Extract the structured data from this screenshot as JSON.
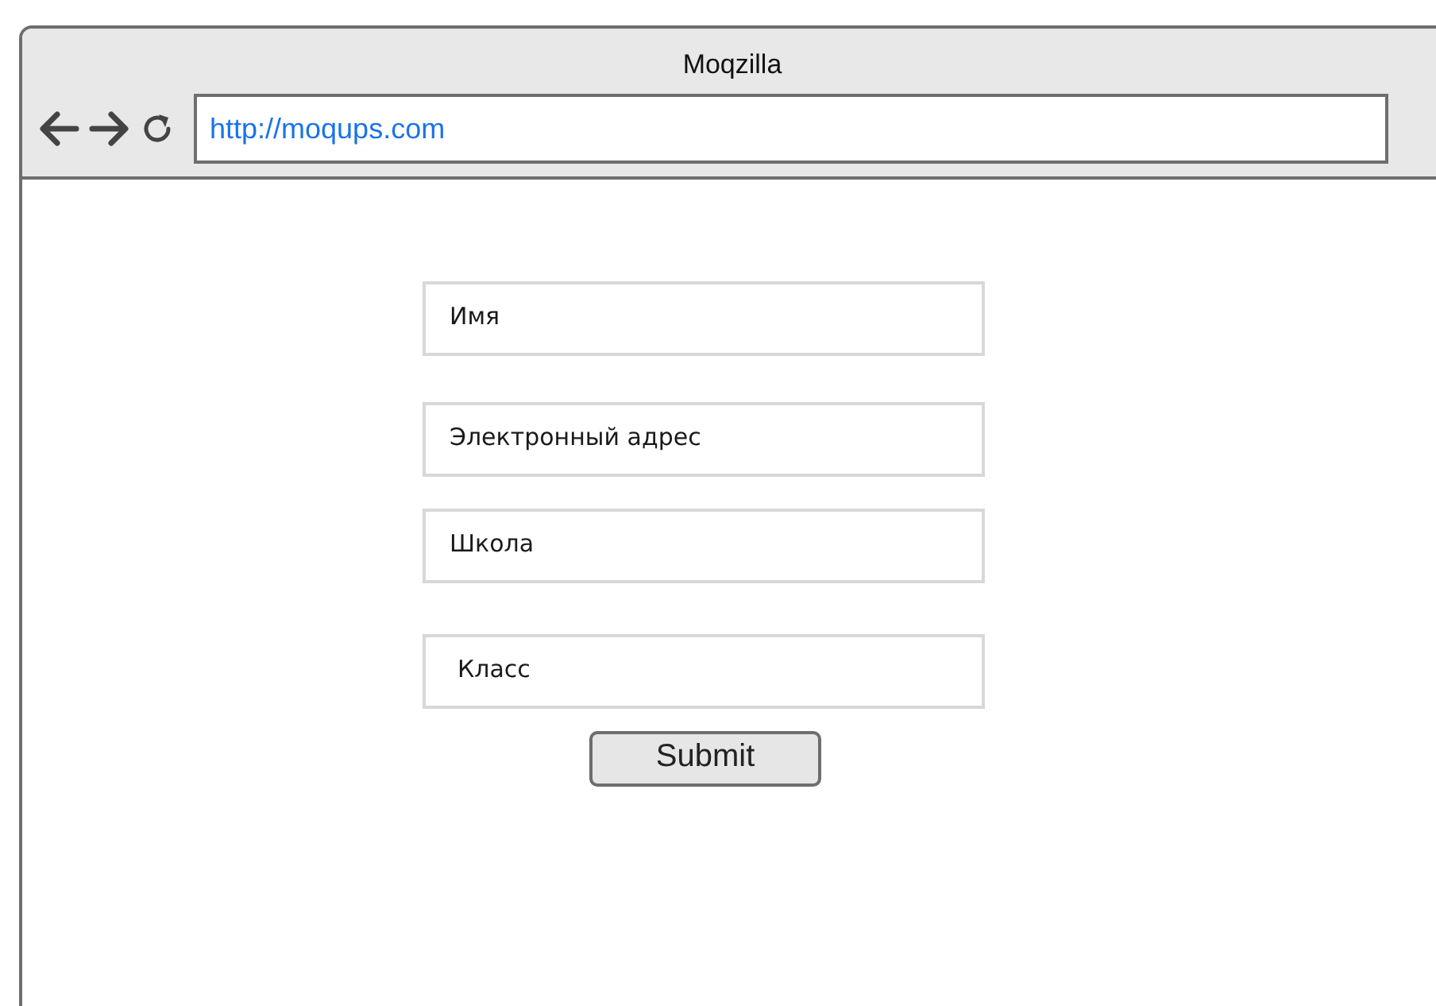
{
  "window": {
    "title": "Moqzilla"
  },
  "address_bar": {
    "value": "http://moqups.com"
  },
  "form": {
    "fields": [
      {
        "placeholder": "Имя"
      },
      {
        "placeholder": "Электронный адрес"
      },
      {
        "placeholder": "Школа"
      },
      {
        "placeholder": "Класс"
      }
    ],
    "submit": "Submit"
  }
}
